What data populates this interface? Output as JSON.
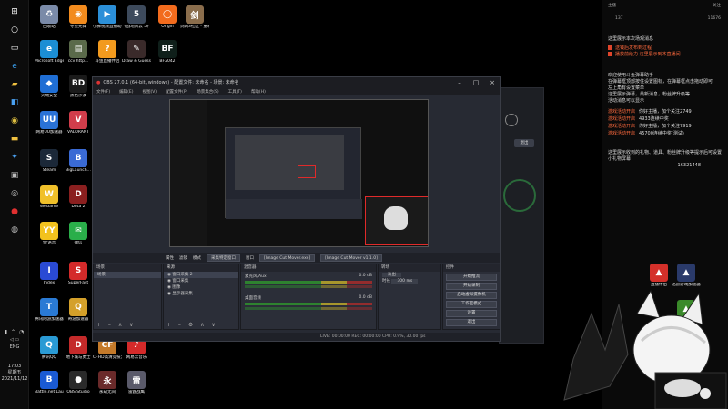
{
  "taskbar": {
    "buttons": [
      "windows-icon",
      "search-icon",
      "task-view-icon",
      "edge-icon",
      "file-explorer-icon",
      "store-icon",
      "chrome-icon",
      "folder-icon",
      "settings-icon",
      "app-icon",
      "steam-icon",
      "obs-icon",
      "netease-icon",
      "wegame-icon"
    ],
    "tray_lang": "ENG",
    "clock_time": "17:03",
    "clock_day": "星期五",
    "clock_date": "2021/11/12"
  },
  "desktop": {
    "icons": [
      {
        "label": "回收站",
        "icon": "recycle-bin-icon",
        "color": "#7a8aa8",
        "glyph": "♻"
      },
      {
        "label": "守望先锋",
        "icon": "overwatch-icon",
        "color": "#f28b1e",
        "glyph": "◉"
      },
      {
        "label": "小狮视频直播助手",
        "icon": "video-assistant-icon",
        "color": "#2b8fd8",
        "glyph": "▶"
      },
      {
        "label": "《战地风云 5》",
        "icon": "battlefield-icon",
        "color": "#3d4a5c",
        "glyph": "5"
      },
      {
        "label": "Origin",
        "icon": "origin-icon",
        "color": "#f26b1d",
        "glyph": "◯"
      },
      {
        "label": "剑网3社区 - 重制...",
        "icon": "jx3-icon",
        "color": "#8a6d4c",
        "glyph": "剑"
      },
      {
        "label": "Microsoft Edge",
        "icon": "edge-icon",
        "color": "#1b8ed4",
        "glyph": "e"
      },
      {
        "label": "ccv http...",
        "icon": "file-icon",
        "color": "#5a6a4a",
        "glyph": "▤"
      },
      {
        "label": "斗鱼直播伴侣",
        "icon": "douyu-icon",
        "color": "#f29a1e",
        "glyph": "?"
      },
      {
        "label": "Draw & Guess",
        "icon": "draw-guess-icon",
        "color": "#3a2a2a",
        "glyph": "✎"
      },
      {
        "label": "BF2042",
        "icon": "bf2042-icon",
        "color": "#0f1f1a",
        "glyph": "BF"
      },
      {
        "label": "火绒安全",
        "icon": "huorong-icon",
        "color": "#1f6ed4",
        "glyph": "◆"
      },
      {
        "label": "黑色沙漠",
        "icon": "black-desert-icon",
        "color": "#1a1a1a",
        "glyph": "BD"
      },
      {
        "label": "网易UU加速器",
        "icon": "uu-icon",
        "color": "#2a72d6",
        "glyph": "UU"
      },
      {
        "label": "VALORANT",
        "icon": "valorant-icon",
        "color": "#d13d4b",
        "glyph": "V"
      },
      {
        "label": "Steam",
        "icon": "steam-icon",
        "color": "#1b2838",
        "glyph": "S"
      },
      {
        "label": "BigLaunch...",
        "icon": "biglaunch-icon",
        "color": "#3a6ad4",
        "glyph": "B"
      },
      {
        "label": "完美世界竞技平台",
        "icon": "perfect-world-icon",
        "color": "#cc3a2a",
        "glyph": "完"
      },
      {
        "label": "WeGame",
        "icon": "wegame-icon",
        "color": "#f0c02a",
        "glyph": "W"
      },
      {
        "label": "Dota 2",
        "icon": "dota2-icon",
        "color": "#8a1f1f",
        "glyph": "D"
      },
      {
        "label": "YY语音",
        "icon": "yy-icon",
        "color": "#f2c21e",
        "glyph": "YY"
      },
      {
        "label": "微信",
        "icon": "wechat-icon",
        "color": "#2aae4a",
        "glyph": "✉"
      },
      {
        "label": "Index",
        "icon": "index-icon",
        "color": "#2a4ad4",
        "glyph": "I"
      },
      {
        "label": "SuperFast",
        "icon": "superfast-icon",
        "color": "#d42a2a",
        "glyph": "S"
      },
      {
        "label": "腾讯网游加速器",
        "icon": "tencent-accel-icon",
        "color": "#2a7ad4",
        "glyph": "T"
      },
      {
        "label": "奇游加速器",
        "icon": "qiyou-icon",
        "color": "#d4a02a",
        "glyph": "Q"
      },
      {
        "label": "腾讯QQ",
        "icon": "qq-icon",
        "color": "#2a9ad4",
        "glyph": "Q"
      },
      {
        "label": "地下城与勇士",
        "icon": "dnf-icon",
        "color": "#c42a2a",
        "glyph": "D"
      },
      {
        "label": "CFHD高清竞技大区",
        "icon": "cf-icon",
        "color": "#c47a2a",
        "glyph": "CF"
      },
      {
        "label": "网易云音乐",
        "icon": "netease-music-icon",
        "color": "#d42a2a",
        "glyph": "♪"
      },
      {
        "label": "Battle.net Launcher...",
        "icon": "battlenet-icon",
        "color": "#1a5ad4",
        "glyph": "B"
      },
      {
        "label": "OBS Studio",
        "icon": "obs-studio-icon",
        "color": "#2a2a2a",
        "glyph": "●"
      },
      {
        "label": "永劫无间",
        "icon": "naraka-icon",
        "color": "#6a2a2a",
        "glyph": "永"
      },
      {
        "label": "雷霆战鹰",
        "icon": "game-icon",
        "color": "#5a5a6a",
        "glyph": "雷"
      }
    ]
  },
  "obs": {
    "title": "OBS 27.0.1 (64-bit, windows) - 配置文件: 未命名 - 场景: 未命名",
    "menu": [
      "文件(F)",
      "编辑(E)",
      "视图(V)",
      "配置文件(P)",
      "场景集合(S)",
      "工具(T)",
      "帮助(H)"
    ],
    "source_bar": {
      "props": "属性",
      "filters": "滤镜",
      "mode_label": "模式",
      "mode_value": "采集特定窗口",
      "window_label": "窗口",
      "window_value": "[Image Cut Mover.exe]",
      "window_value2": "[Image Cut Mover v1.1.0]"
    },
    "scenes": {
      "header": "场景",
      "items": [
        "场景"
      ]
    },
    "sources": {
      "header": "来源",
      "items": [
        "窗口采集 2",
        "窗口采集",
        "图像",
        "显示器采集"
      ]
    },
    "mixer": {
      "header": "混音器",
      "tracks": [
        {
          "name": "麦克风/Aux",
          "db": "0.0 dB"
        },
        {
          "name": "桌面音频",
          "db": "0.0 dB"
        }
      ]
    },
    "transitions": {
      "header": "转场",
      "type": "淡出",
      "duration_label": "时长",
      "duration": "300 ms"
    },
    "controls": {
      "header": "控件",
      "buttons": [
        "开始推流",
        "开始录制",
        "启动虚拟摄像机",
        "工作室模式",
        "设置",
        "退出"
      ]
    },
    "status": "LIVE: 00:00:00   REC: 00:00:00   CPU: 0.9%, 30.00 fps"
  },
  "right_panel": {
    "stats": [
      "主播",
      "137",
      "关注",
      "11676"
    ],
    "top_text": "这里展示本次场观消息",
    "notices": [
      "送钱后发布到过程",
      "播放前给力 这里展示到本直播间"
    ],
    "chat": [
      "欢迎使用斗鱼弹幕助手",
      "在弹幕框顶部按住设置图标，在弹幕框点击拖动即可",
      "左上角有设置菜单",
      "这里展示弹幕，最新消息，粉丝牌升级等",
      "活动消息可以显示"
    ],
    "gifts": [
      {
        "tag": "游戏活动开启",
        "text": "你好主播，加个关注2749"
      },
      {
        "tag": "游戏活动开启",
        "text": "4933连续中奖"
      },
      {
        "tag": "游戏活动开启",
        "text": "你好主播，加个关注7919"
      },
      {
        "tag": "游戏活动开启",
        "text": "45700连续中奖(测试)"
      }
    ],
    "bottom_text": "这里展示收到的礼物、道具、粉丝牌升级等提示后可设置小礼物屏幕",
    "bottom_value": "16321448",
    "app_icons": [
      {
        "label": "直播伴侣",
        "icon": "live-companion-icon",
        "color": "#d4302a"
      },
      {
        "label": "迅游游戏加速器",
        "icon": "xunyou-icon",
        "color": "#2a3a6a"
      },
      {
        "label": "GeForce Experience",
        "icon": "geforce-icon",
        "color": "#3a8a2a"
      }
    ]
  },
  "bg_window": {
    "button": "退出"
  }
}
